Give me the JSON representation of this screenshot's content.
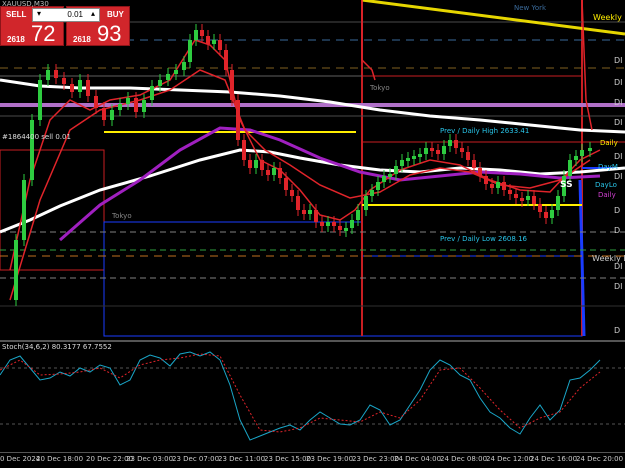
{
  "window": {
    "symbol_title": "XAUUSD,M30"
  },
  "trade": {
    "sell_label": "SELL",
    "buy_label": "BUY",
    "lot_value": "0.01",
    "sell_price_prefix": "2618",
    "sell_price_big": "72",
    "buy_price_prefix": "2618",
    "buy_price_big": "93"
  },
  "labels": {
    "new_york": "New York",
    "weekly_high": "Weekly Hi",
    "tokyo_top": "Tokyo",
    "tokyo_left": "Tokyo",
    "order_line": "#1864400 sell 0.01",
    "prev_daily_high": "Prev / Daily High 2633.41",
    "prev_daily_low": "Prev / Daily Low 2608.16",
    "daily_label": "Daily",
    "daymid_label": "DayM",
    "daylow_label": "DayLo",
    "daily_pink": "Daily",
    "weekly_low": "Weekly L",
    "ss": "SS",
    "stoch": "Stoch(34,6,2) 80.3177 67.7552"
  },
  "right_labels": [
    "DI",
    "DI",
    "DI",
    "DI",
    "DI",
    "DI",
    "D",
    "D",
    "DI",
    "DI",
    "D"
  ],
  "time_axis": [
    "0 Dec 2024",
    "20 Dec 18:00",
    "20 Dec 22:00",
    "23 Dec 03:00",
    "23 Dec 07:00",
    "23 Dec 11:00",
    "23 Dec 15:00",
    "23 Dec 19:00",
    "23 Dec 23:00",
    "24 Dec 04:00",
    "24 Dec 08:00",
    "24 Dec 12:00",
    "24 Dec 16:00",
    "24 Dec 20:00"
  ],
  "colors": {
    "bull": "#2ecc40",
    "bear": "#e0242a",
    "ma_white": "#ffffff",
    "ma_purple": "#a020c0",
    "ma_red": "#e0242a",
    "yellow": "#ffee00",
    "blue": "#1a3cff",
    "pink_level": "#c07ad8",
    "stoch_main": "#1aa6c8",
    "stoch_signal": "#e0242a"
  }
}
